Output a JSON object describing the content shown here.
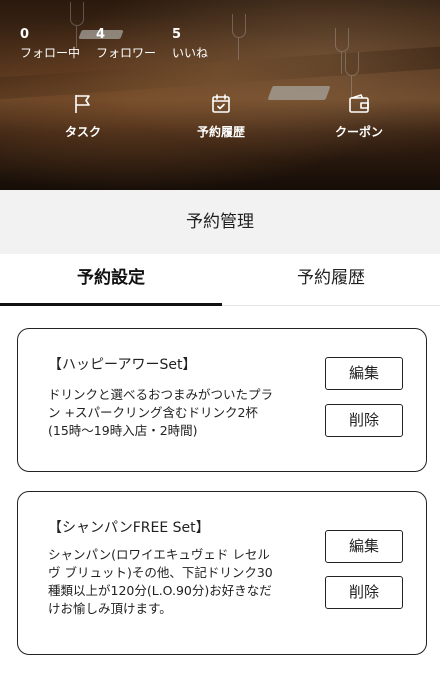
{
  "profile_stats": [
    {
      "count": "0",
      "label": "フォロー中"
    },
    {
      "count": "4",
      "label": "フォロワー"
    },
    {
      "count": "5",
      "label": "いいね"
    }
  ],
  "quick_nav": [
    {
      "label": "タスク",
      "icon": "flag-icon"
    },
    {
      "label": "予約履歴",
      "icon": "calendar-check-icon"
    },
    {
      "label": "クーポン",
      "icon": "wallet-icon"
    }
  ],
  "page_title": "予約管理",
  "tabs": [
    {
      "label": "予約設定",
      "active": true
    },
    {
      "label": "予約履歴",
      "active": false
    }
  ],
  "reservations": [
    {
      "title": "【ハッピーアワーSet】",
      "description_lines": [
        "ドリンクと選べるおつまみがついたプラ",
        "ン +スパークリング含むドリンク2杯",
        "(15時〜19時入店・2時間)"
      ],
      "edit_label": "編集",
      "delete_label": "削除"
    },
    {
      "title": "【シャンパンFREE Set】",
      "description_lines": [
        "シャンパン(ロワイエキュヴェド レセル",
        "ヴ ブリュット)その他、下記ドリンク30",
        "種類以上が120分(L.O.90分)お好きなだ",
        "けお愉しみ頂けます。"
      ],
      "edit_label": "編集",
      "delete_label": "削除"
    }
  ],
  "colors": {
    "title_band": "#f2f2f2",
    "border": "#222222",
    "text": "#1a1a1a"
  }
}
